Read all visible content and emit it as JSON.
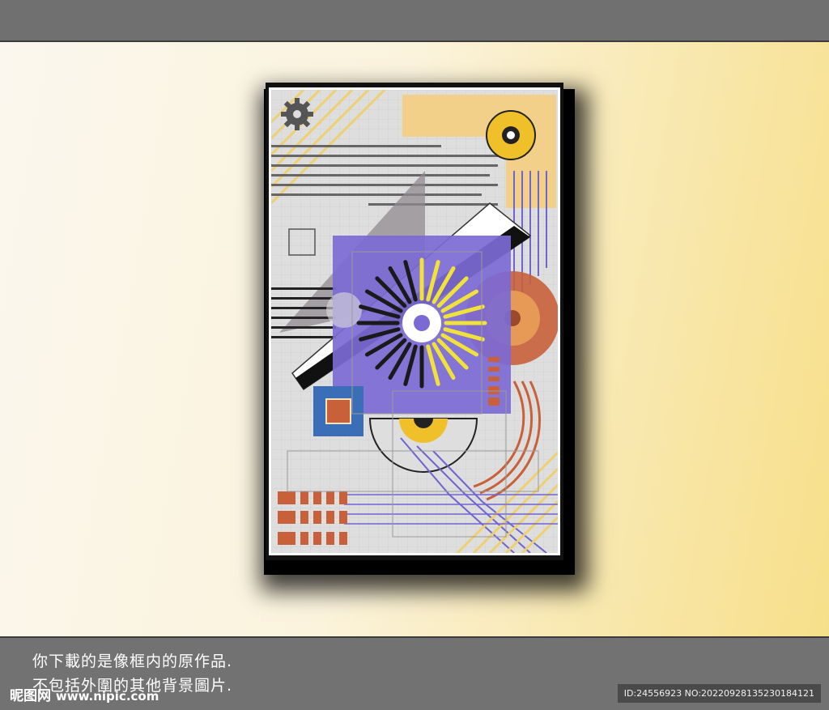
{
  "caption": {
    "line1": "你下載的是像框内的原作品.",
    "line2": "不包括外圍的其他背景圖片."
  },
  "watermark": {
    "brand": "昵图网",
    "site": "www.nipic.com"
  },
  "image_id": "ID:24556923 NO:20220928135230184121",
  "colors": {
    "purple": "#7b6ad4",
    "yellow": "#f0d23a",
    "orange": "#c8603a",
    "blue": "#3a6fb8",
    "gray_bg": "#dedede",
    "peach": "#f2d08a"
  }
}
